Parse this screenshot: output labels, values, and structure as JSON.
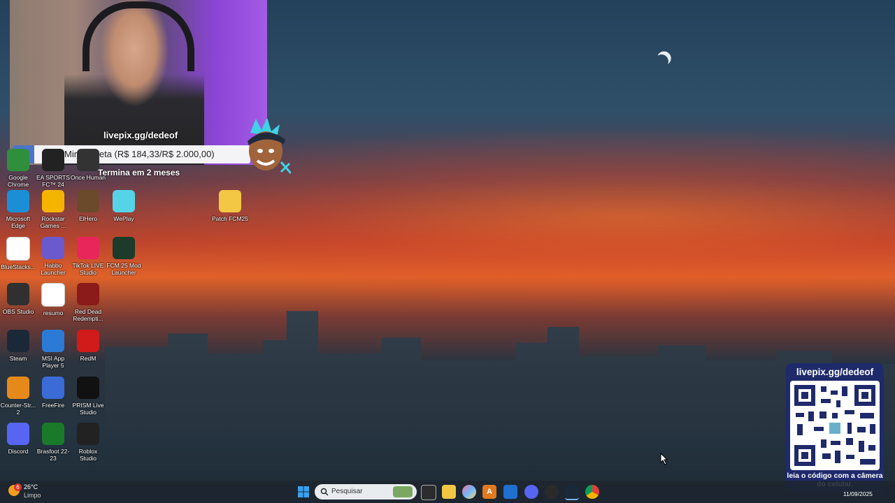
{
  "livepix": {
    "overlay_label": "livepix.gg/dedeof",
    "goal_text": "Minha meta (R$ 184,33/R$ 2.000,00)",
    "goal_progress": 0.092,
    "goal_subtext": "Termina em 2 meses",
    "qr_title": "livepix.gg/dedeof",
    "qr_caption": "leia o código com a câmera do celular."
  },
  "desktop_icons": [
    {
      "label": "Google Chrome",
      "icon": "chrome-icon",
      "color": "#2f8f3c"
    },
    {
      "label": "EA SPORTS FC™ 24",
      "icon": "ea-fc-icon",
      "color": "#222222"
    },
    {
      "label": "Once Human",
      "icon": "once-human-icon",
      "color": "#333333"
    },
    {
      "label": "Microsoft Edge",
      "icon": "edge-icon",
      "color": "#1a8fd6"
    },
    {
      "label": "Rockstar Games ...",
      "icon": "rockstar-icon",
      "color": "#f5b400"
    },
    {
      "label": "ElHero",
      "icon": "elhero-icon",
      "color": "#6a4a2a"
    },
    {
      "label": "WePlay",
      "icon": "weplay-icon",
      "color": "#55d4e8"
    },
    {
      "label": "Patch FCM25",
      "icon": "folder-icon",
      "color": "#f3c744"
    },
    {
      "label": "BlueStacks...",
      "icon": "file-icon",
      "color": "#ffffff"
    },
    {
      "label": "Habbo Launcher",
      "icon": "habbo-icon",
      "color": "#6a5acd"
    },
    {
      "label": "TikTok LIVE Studio",
      "icon": "tiktok-icon",
      "color": "#e8265a"
    },
    {
      "label": "FCM 25 Mod Launcher",
      "icon": "fcm-icon",
      "color": "#1d3b2a"
    },
    {
      "label": "OBS Studio",
      "icon": "obs-icon",
      "color": "#303030"
    },
    {
      "label": "resumo",
      "icon": "text-file-icon",
      "color": "#ffffff"
    },
    {
      "label": "Red Dead Redempti...",
      "icon": "rdr-icon",
      "color": "#8b1a1a"
    },
    {
      "label": "Steam",
      "icon": "steam-icon",
      "color": "#1b2838"
    },
    {
      "label": "MSI App Player 5",
      "icon": "msi-icon",
      "color": "#2b7bd6"
    },
    {
      "label": "RedM",
      "icon": "redm-icon",
      "color": "#d11a1a"
    },
    {
      "label": "Counter-Str... 2",
      "icon": "cs2-icon",
      "color": "#e58a1a"
    },
    {
      "label": "FreeFire",
      "icon": "freefire-icon",
      "color": "#3a6bd6"
    },
    {
      "label": "PRISM Live Studio",
      "icon": "prism-icon",
      "color": "#111111"
    },
    {
      "label": "Discord",
      "icon": "discord-icon",
      "color": "#5865f2"
    },
    {
      "label": "Brasfoot 22-23",
      "icon": "brasfoot-icon",
      "color": "#1a7a2a"
    },
    {
      "label": "Roblox Studio",
      "icon": "roblox-icon",
      "color": "#222222"
    }
  ],
  "taskbar": {
    "search_placeholder": "Pesquisar",
    "weather_badge": "6",
    "weather_temp": "26°C",
    "weather_desc": "Limpo",
    "date": "11/09/2025"
  }
}
